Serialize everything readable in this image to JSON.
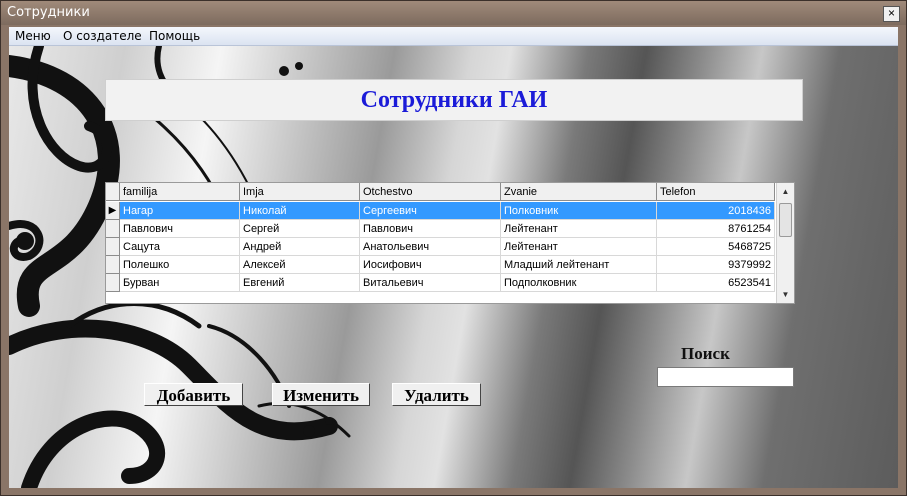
{
  "window": {
    "title": "Сотрудники",
    "close_glyph": "×"
  },
  "menu": {
    "items": [
      "Меню",
      "О создателе",
      "Помощь"
    ]
  },
  "header": {
    "title": "Сотрудники ГАИ"
  },
  "table": {
    "columns": [
      "familija",
      "Imja",
      "Otchestvo",
      "Zvanie",
      "Telefon"
    ],
    "rows": [
      [
        "Нагар",
        "Николай",
        "Сергеевич",
        "Полковник",
        "2018436"
      ],
      [
        "Павлович",
        "Сергей",
        "Павлович",
        "Лейтенант",
        "8761254"
      ],
      [
        "Сацута",
        "Андрей",
        "Анатольевич",
        "Лейтенант",
        "5468725"
      ],
      [
        "Полешко",
        "Алексей",
        "Иосифович",
        "Младший лейтенант",
        "9379992"
      ],
      [
        "Бурван",
        "Евгений",
        "Витальевич",
        "Подполковник",
        "6523541"
      ]
    ],
    "selected_row_index": 0,
    "current_row_marker": "▶"
  },
  "buttons": {
    "add": "Добавить",
    "edit": "Изменить",
    "delete": "Удалить"
  },
  "search": {
    "label": "Поиск",
    "value": ""
  },
  "colors": {
    "title_blue": "#1b1bd8",
    "selection_blue": "#3399ff"
  },
  "icons": {
    "close": "close-icon",
    "scroll_up": "scroll-up-arrow-icon",
    "scroll_down": "scroll-down-arrow-icon",
    "row_pointer": "row-pointer-icon"
  }
}
